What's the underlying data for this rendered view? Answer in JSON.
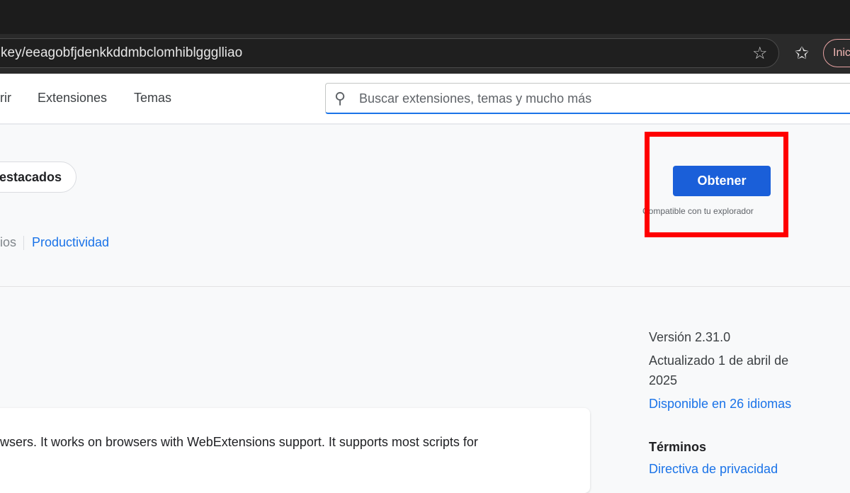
{
  "browser": {
    "url": "key/eeagobfjdenkkddmbclomhiblggglliao",
    "signin_label": "Inic"
  },
  "nav": {
    "partial_item": "rir",
    "extensions": "Extensiones",
    "themes": "Temas"
  },
  "search": {
    "placeholder": "Buscar extensiones, temas y mucho más"
  },
  "badge": {
    "featured": "estacados"
  },
  "categories": {
    "partial": "ios",
    "productivity": "Productividad"
  },
  "action": {
    "get_label": "Obtener",
    "compat": "Compatible con tu explorador"
  },
  "details": {
    "version": "Versión 2.31.0",
    "updated_line1": "Actualizado 1 de abril de",
    "updated_line2": "2025",
    "languages": "Disponible en 26 idiomas",
    "terms_heading": "Términos",
    "privacy": "Directiva de privacidad"
  },
  "description": "wsers. It works on browsers with WebExtensions support. It supports most scripts for"
}
